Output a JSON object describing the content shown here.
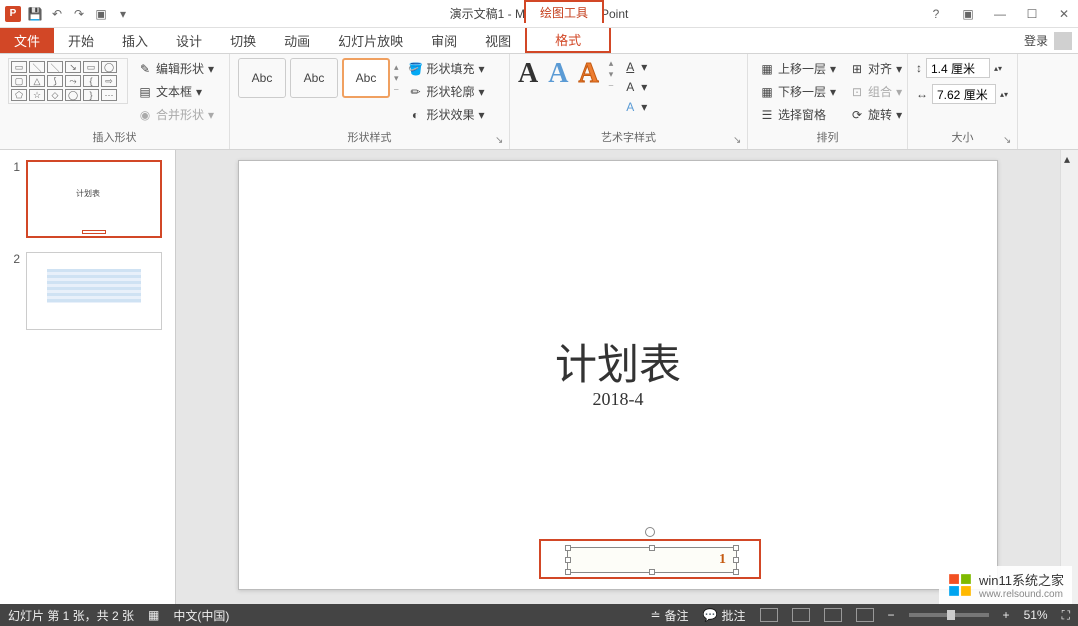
{
  "titlebar": {
    "doc_title": "演示文稿1 - Microsoft PowerPoint",
    "contextual_tools": "绘图工具"
  },
  "tabs": {
    "file": "文件",
    "home": "开始",
    "insert": "插入",
    "design": "设计",
    "transitions": "切换",
    "animations": "动画",
    "slideshow": "幻灯片放映",
    "review": "审阅",
    "view": "视图",
    "format": "格式",
    "login": "登录"
  },
  "ribbon": {
    "insert_shapes": {
      "label": "插入形状",
      "edit_shape": "编辑形状",
      "text_box": "文本框",
      "merge_shapes": "合并形状"
    },
    "shape_styles": {
      "label": "形状样式",
      "sample": "Abc",
      "fill": "形状填充",
      "outline": "形状轮廓",
      "effects": "形状效果"
    },
    "wordart_styles": {
      "label": "艺术字样式",
      "glyph": "A"
    },
    "arrange": {
      "label": "排列",
      "bring_forward": "上移一层",
      "send_backward": "下移一层",
      "selection_pane": "选择窗格",
      "align": "对齐",
      "group": "组合",
      "rotate": "旋转"
    },
    "size": {
      "label": "大小",
      "height": "1.4 厘米",
      "width": "7.62 厘米"
    }
  },
  "thumbnails": {
    "s1": "1",
    "s1_title": "计划表",
    "s2": "2"
  },
  "slide": {
    "title": "计划表",
    "subtitle": "2018-4",
    "shape_number": "1"
  },
  "statusbar": {
    "slide_info": "幻灯片 第 1 张，共 2 张",
    "lang": "中文(中国)",
    "notes": "备注",
    "comments": "批注",
    "zoom": "51%"
  },
  "watermark": {
    "line1": "win11系统之家",
    "line2": "www.relsound.com"
  }
}
